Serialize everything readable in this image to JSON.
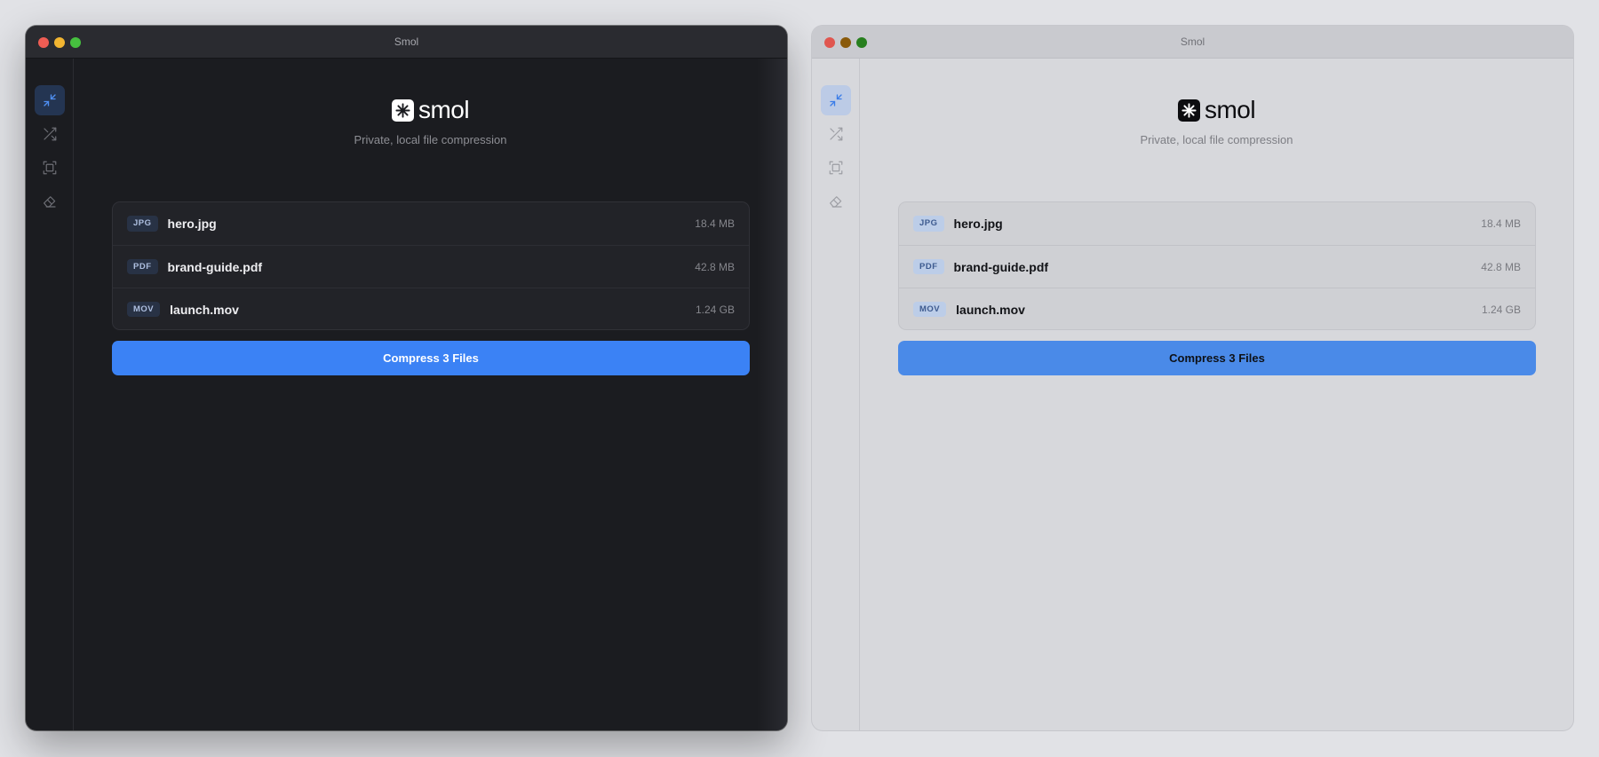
{
  "windows": [
    {
      "theme": "dark",
      "title": "Smol",
      "app": {
        "logo_text": "smol",
        "tagline": "Private, local file compression"
      },
      "sidebar": [
        {
          "icon": "compress-icon",
          "active": true
        },
        {
          "icon": "shuffle-icon",
          "active": false
        },
        {
          "icon": "crop-frame-icon",
          "active": false
        },
        {
          "icon": "eraser-icon",
          "active": false
        }
      ],
      "files": [
        {
          "type": "JPG",
          "name": "hero.jpg",
          "size": "18.4 MB"
        },
        {
          "type": "PDF",
          "name": "brand-guide.pdf",
          "size": "42.8 MB"
        },
        {
          "type": "MOV",
          "name": "launch.mov",
          "size": "1.24 GB"
        }
      ],
      "action_label": "Compress 3 Files",
      "accent_color": "#3b82f5"
    },
    {
      "theme": "light",
      "title": "Smol",
      "app": {
        "logo_text": "smol",
        "tagline": "Private, local file compression"
      },
      "sidebar": [
        {
          "icon": "compress-icon",
          "active": true
        },
        {
          "icon": "shuffle-icon",
          "active": false
        },
        {
          "icon": "crop-frame-icon",
          "active": false
        },
        {
          "icon": "eraser-icon",
          "active": false
        }
      ],
      "files": [
        {
          "type": "JPG",
          "name": "hero.jpg",
          "size": "18.4 MB"
        },
        {
          "type": "PDF",
          "name": "brand-guide.pdf",
          "size": "42.8 MB"
        },
        {
          "type": "MOV",
          "name": "launch.mov",
          "size": "1.24 GB"
        }
      ],
      "action_label": "Compress 3 Files",
      "accent_color": "#4a8ae8"
    }
  ]
}
